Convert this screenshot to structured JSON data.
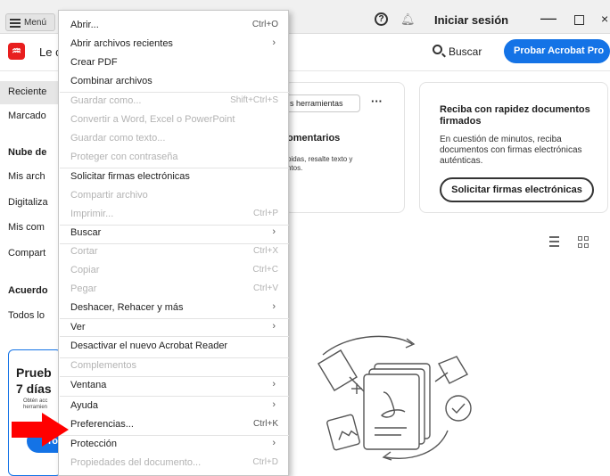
{
  "titlebar": {
    "menu_label": "Menú",
    "sign_in": "Iniciar sesión",
    "min_glyph": "—",
    "close_glyph": "×"
  },
  "toolbar": {
    "doc_title": "Le c",
    "search_label": "Buscar",
    "try_button": "Probar Acrobat Pro"
  },
  "sidebar": {
    "items": [
      "Reciente",
      "Marcado",
      "Nube de",
      "Mis arch",
      "Digitaliza",
      "Mis com",
      "Compart",
      "Acuerdo",
      "Todos lo"
    ]
  },
  "promo": {
    "title": "Prueb",
    "subtitle": "7 días",
    "small_line1": "Obtén acc",
    "small_line2": "herramien",
    "button": "rol"
  },
  "card_tools": {
    "pill": "s herramientas",
    "dots": "···",
    "title": "omentarios",
    "desc_line1": "pidas, resalte texto y",
    "desc_line2": "ntos."
  },
  "card_sign": {
    "title": "Reciba con rapidez documentos firmados",
    "desc": "En cuestión de minutos, reciba documentos con firmas electrónicas auténticas.",
    "button": "Solicitar firmas electrónicas"
  },
  "menu": {
    "items": [
      {
        "label": "Abrir...",
        "shortcut": "Ctrl+O",
        "arrow": "",
        "disabled": false
      },
      {
        "label": "Abrir archivos recientes",
        "shortcut": "",
        "arrow": "›",
        "disabled": false
      },
      {
        "label": "Crear PDF",
        "shortcut": "",
        "arrow": "",
        "disabled": false
      },
      {
        "label": "Combinar archivos",
        "shortcut": "",
        "arrow": "",
        "disabled": false
      },
      {
        "label": "Guardar como...",
        "shortcut": "Shift+Ctrl+S",
        "arrow": "",
        "disabled": true
      },
      {
        "label": "Convertir a Word, Excel o PowerPoint",
        "shortcut": "",
        "arrow": "",
        "disabled": true
      },
      {
        "label": "Guardar como texto...",
        "shortcut": "",
        "arrow": "",
        "disabled": true
      },
      {
        "label": "Proteger con contraseña",
        "shortcut": "",
        "arrow": "",
        "disabled": true
      },
      {
        "label": "Solicitar firmas electrónicas",
        "shortcut": "",
        "arrow": "",
        "disabled": false
      },
      {
        "label": "Compartir archivo",
        "shortcut": "",
        "arrow": "",
        "disabled": true
      },
      {
        "label": "Imprimir...",
        "shortcut": "Ctrl+P",
        "arrow": "",
        "disabled": true
      },
      {
        "label": "Buscar",
        "shortcut": "",
        "arrow": "›",
        "disabled": false
      },
      {
        "label": "Cortar",
        "shortcut": "Ctrl+X",
        "arrow": "",
        "disabled": true
      },
      {
        "label": "Copiar",
        "shortcut": "Ctrl+C",
        "arrow": "",
        "disabled": true
      },
      {
        "label": "Pegar",
        "shortcut": "Ctrl+V",
        "arrow": "",
        "disabled": true
      },
      {
        "label": "Deshacer, Rehacer y más",
        "shortcut": "",
        "arrow": "›",
        "disabled": false
      },
      {
        "label": "Ver",
        "shortcut": "",
        "arrow": "›",
        "disabled": false
      },
      {
        "label": "Desactivar el nuevo Acrobat Reader",
        "shortcut": "",
        "arrow": "",
        "disabled": false
      },
      {
        "label": "Complementos",
        "shortcut": "",
        "arrow": "",
        "disabled": true
      },
      {
        "label": "Ventana",
        "shortcut": "",
        "arrow": "›",
        "disabled": false
      },
      {
        "label": "Ayuda",
        "shortcut": "",
        "arrow": "›",
        "disabled": false
      },
      {
        "label": "Preferencias...",
        "shortcut": "Ctrl+K",
        "arrow": "",
        "disabled": false
      },
      {
        "label": "Protección",
        "shortcut": "",
        "arrow": "›",
        "disabled": false
      },
      {
        "label": "Propiedades del documento...",
        "shortcut": "Ctrl+D",
        "arrow": "",
        "disabled": true
      }
    ]
  },
  "icons": {
    "menu": "hamburger-icon",
    "help": "help-icon",
    "bell": "bell-icon",
    "adobe": "adobe-acrobat-icon",
    "search": "search-icon",
    "list_view": "list-view-icon",
    "grid_view": "grid-view-icon",
    "annotation": "red-arrow-annotation"
  },
  "colors": {
    "accent": "#1473e6",
    "adobe_red": "#e81e1e",
    "annotation_red": "#ff0000",
    "disabled_text": "#b3b3b3"
  }
}
